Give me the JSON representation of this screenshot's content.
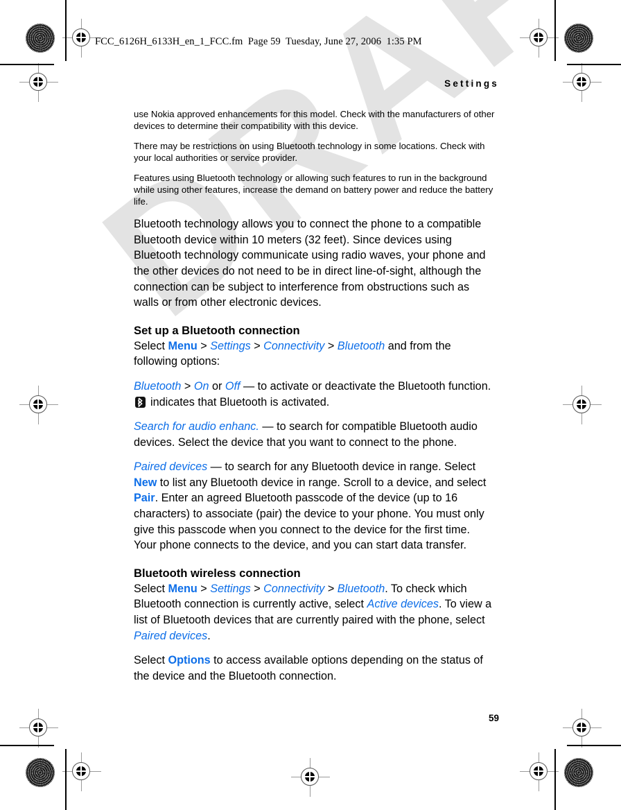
{
  "document": {
    "fm_header": "FCC_6126H_6133H_en_1_FCC.fm  Page 59  Tuesday, June 27, 2006  1:35 PM",
    "running_head": "Settings",
    "folio": "59",
    "watermark": "DRAFT",
    "accent_color": "#0d6ee8",
    "watermark_color": "#e3e3e3",
    "page_background": "#ffffff",
    "text_color": "#000000"
  },
  "body": {
    "paragraph_1": "use Nokia approved enhancements for this model. Check with the manufacturers of other devices to determine their compatibility with this device.",
    "paragraph_2": "There may be restrictions on using Bluetooth technology in some locations. Check with your local authorities or service provider.",
    "paragraph_3": "Features using Bluetooth technology or allowing such features to run in the background while using other features, increase the demand on battery power and reduce the battery life.",
    "paragraph_4": "Bluetooth technology allows you to connect the phone to a compatible Bluetooth device within 10 meters (32 feet). Since devices using Bluetooth technology communicate using radio waves, your phone and the other devices do not need to be in direct line-of-sight, although the connection can be subject to interference from obstructions such as walls or from other electronic devices."
  },
  "section_setup": {
    "heading": "Set up a Bluetooth connection",
    "intro_lead": "Select ",
    "menu_label": "Menu",
    "sep_1": " > ",
    "settings_label": "Settings",
    "sep_2": " > ",
    "connectivity_label": "Connectivity",
    "sep_3": " > ",
    "bluetooth_label": "Bluetooth",
    "intro_tail": " and from the following options:",
    "option_bluetooth": {
      "term": "Bluetooth",
      "sep": " > ",
      "value_on": "On",
      "conjunction": " or ",
      "value_off": "Off",
      "desc_before_icon": " — to activate or deactivate the Bluetooth function. ",
      "icon": "bluetooth-icon",
      "desc_after_icon": "indicates that Bluetooth is activated."
    },
    "option_search_audio": {
      "term": "Search for audio enhanc.",
      "desc": " — to search for compatible Bluetooth audio devices. Select the device that you want to connect to the phone."
    },
    "option_paired": {
      "term": "Paired devices",
      "desc_1": " — to search for any Bluetooth device in range. Select ",
      "new_label": "New",
      "desc_2": " to list any Bluetooth device in range. Scroll to a device, and select ",
      "pair_label": "Pair",
      "desc_3": ". Enter an agreed Bluetooth passcode of the device (up to 16 characters) to associate (pair) the device to your phone. You must only give this passcode when you connect to the device for the first time. Your phone connects to the device, and you can start data transfer."
    }
  },
  "section_wireless": {
    "heading": "Bluetooth wireless connection",
    "lead": "Select ",
    "menu_label": "Menu",
    "sep_1": " > ",
    "settings_label": "Settings",
    "sep_2": " > ",
    "connectivity_label": "Connectivity",
    "sep_3": " > ",
    "bluetooth_label": "Bluetooth",
    "mid_1": ". To check which Bluetooth connection is currently active, select ",
    "active_devices_label": "Active devices",
    "mid_2": ". To view a list of Bluetooth devices that are currently paired with the phone, select ",
    "paired_devices_label": "Paired devices",
    "mid_3": ".",
    "options_lead": "Select ",
    "options_label": "Options",
    "options_tail": " to access available options depending on the status of the device and the Bluetooth connection."
  }
}
